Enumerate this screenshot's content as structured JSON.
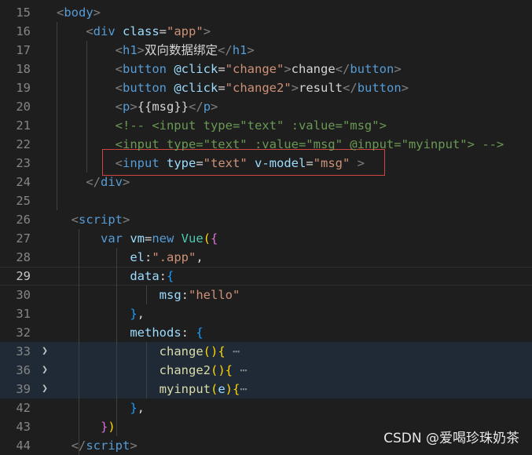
{
  "editor": {
    "lines": [
      {
        "num": "15",
        "code": [
          [
            "bracket",
            "<"
          ],
          [
            "tag",
            "body"
          ],
          [
            "bracket",
            ">"
          ]
        ]
      },
      {
        "num": "16",
        "code": [
          [
            "txt",
            "    "
          ],
          [
            "bracket",
            "<"
          ],
          [
            "tag",
            "div "
          ],
          [
            "attr",
            "class"
          ],
          [
            "punc",
            "="
          ],
          [
            "str",
            "\"app\""
          ],
          [
            "bracket",
            ">"
          ]
        ]
      },
      {
        "num": "17",
        "code": [
          [
            "txt",
            "        "
          ],
          [
            "bracket",
            "<"
          ],
          [
            "tag",
            "h1"
          ],
          [
            "bracket",
            ">"
          ],
          [
            "txt",
            "双向数据绑定"
          ],
          [
            "bracket",
            "</"
          ],
          [
            "tag",
            "h1"
          ],
          [
            "bracket",
            ">"
          ]
        ]
      },
      {
        "num": "18",
        "code": [
          [
            "txt",
            "        "
          ],
          [
            "bracket",
            "<"
          ],
          [
            "tag",
            "button "
          ],
          [
            "attr",
            "@click"
          ],
          [
            "punc",
            "="
          ],
          [
            "str",
            "\"change\""
          ],
          [
            "bracket",
            ">"
          ],
          [
            "txt",
            "change"
          ],
          [
            "bracket",
            "</"
          ],
          [
            "tag",
            "button"
          ],
          [
            "bracket",
            ">"
          ]
        ]
      },
      {
        "num": "19",
        "code": [
          [
            "txt",
            "        "
          ],
          [
            "bracket",
            "<"
          ],
          [
            "tag",
            "button "
          ],
          [
            "attr",
            "@click"
          ],
          [
            "punc",
            "="
          ],
          [
            "str",
            "\"change2\""
          ],
          [
            "bracket",
            ">"
          ],
          [
            "txt",
            "result"
          ],
          [
            "bracket",
            "</"
          ],
          [
            "tag",
            "button"
          ],
          [
            "bracket",
            ">"
          ]
        ]
      },
      {
        "num": "20",
        "code": [
          [
            "txt",
            "        "
          ],
          [
            "bracket",
            "<"
          ],
          [
            "tag",
            "p"
          ],
          [
            "bracket",
            ">"
          ],
          [
            "txt",
            "{{msg}}"
          ],
          [
            "bracket",
            "</"
          ],
          [
            "tag",
            "p"
          ],
          [
            "bracket",
            ">"
          ]
        ]
      },
      {
        "num": "21",
        "code": [
          [
            "txt",
            "        "
          ],
          [
            "comment",
            "<!-- <input type=\"text\" :value=\"msg\">"
          ]
        ]
      },
      {
        "num": "22",
        "code": [
          [
            "txt",
            "        "
          ],
          [
            "comment",
            "<input type=\"text\" :value=\"msg\" @input=\"myinput\"> -->"
          ]
        ]
      },
      {
        "num": "23",
        "code": [
          [
            "txt",
            "        "
          ],
          [
            "bracket",
            "<"
          ],
          [
            "tag",
            "input "
          ],
          [
            "attr",
            "type"
          ],
          [
            "punc",
            "="
          ],
          [
            "str",
            "\"text\""
          ],
          [
            "attr",
            " v-model"
          ],
          [
            "punc",
            "="
          ],
          [
            "str",
            "\"msg\""
          ],
          [
            "bracket",
            " >"
          ]
        ]
      },
      {
        "num": "24",
        "code": [
          [
            "txt",
            "    "
          ],
          [
            "bracket",
            "</"
          ],
          [
            "tag",
            "div"
          ],
          [
            "bracket",
            ">"
          ]
        ]
      },
      {
        "num": "25",
        "code": []
      },
      {
        "num": "26",
        "code": [
          [
            "txt",
            "  "
          ],
          [
            "bracket",
            "<"
          ],
          [
            "tag",
            "script"
          ],
          [
            "bracket",
            ">"
          ]
        ]
      },
      {
        "num": "27",
        "code": [
          [
            "txt",
            "      "
          ],
          [
            "kw",
            "var "
          ],
          [
            "prop",
            "vm"
          ],
          [
            "punc",
            "="
          ],
          [
            "kw",
            "new "
          ],
          [
            "cls",
            "Vue"
          ],
          [
            "brace1",
            "("
          ],
          [
            "brace2",
            "{"
          ]
        ]
      },
      {
        "num": "28",
        "code": [
          [
            "txt",
            "          "
          ],
          [
            "prop",
            "el"
          ],
          [
            "punc",
            ":"
          ],
          [
            "str",
            "\".app\""
          ],
          [
            "punc",
            ","
          ]
        ]
      },
      {
        "num": "29",
        "code": [
          [
            "txt",
            "          "
          ],
          [
            "prop",
            "data"
          ],
          [
            "punc",
            ":"
          ],
          [
            "brace3",
            "{"
          ]
        ]
      },
      {
        "num": "30",
        "code": [
          [
            "txt",
            "              "
          ],
          [
            "prop",
            "msg"
          ],
          [
            "punc",
            ":"
          ],
          [
            "str",
            "\"hello\""
          ]
        ]
      },
      {
        "num": "31",
        "code": [
          [
            "txt",
            "          "
          ],
          [
            "brace3",
            "}"
          ],
          [
            "punc",
            ","
          ]
        ]
      },
      {
        "num": "32",
        "code": [
          [
            "txt",
            "          "
          ],
          [
            "prop",
            "methods"
          ],
          [
            "punc",
            ": "
          ],
          [
            "brace3",
            "{"
          ]
        ]
      },
      {
        "num": "33",
        "code": [
          [
            "txt",
            "              "
          ],
          [
            "fn",
            "change"
          ],
          [
            "brace1",
            "()"
          ],
          [
            "brace1",
            "{"
          ],
          [
            "ellipsis",
            " ⋯"
          ]
        ]
      },
      {
        "num": "36",
        "code": [
          [
            "txt",
            "              "
          ],
          [
            "fn",
            "change2"
          ],
          [
            "brace1",
            "()"
          ],
          [
            "brace1",
            "{"
          ],
          [
            "ellipsis",
            " ⋯"
          ]
        ]
      },
      {
        "num": "39",
        "code": [
          [
            "txt",
            "              "
          ],
          [
            "fn",
            "myinput"
          ],
          [
            "brace1",
            "("
          ],
          [
            "prop",
            "e"
          ],
          [
            "brace1",
            ")"
          ],
          [
            "brace1",
            "{"
          ],
          [
            "ellipsis",
            "⋯"
          ]
        ]
      },
      {
        "num": "42",
        "code": [
          [
            "txt",
            "          "
          ],
          [
            "brace3",
            "}"
          ],
          [
            "punc",
            ","
          ]
        ]
      },
      {
        "num": "43",
        "code": [
          [
            "txt",
            "      "
          ],
          [
            "brace2",
            "}"
          ],
          [
            "brace1",
            ")"
          ]
        ]
      },
      {
        "num": "44",
        "code": [
          [
            "txt",
            "  "
          ],
          [
            "bracket",
            "</"
          ],
          [
            "tag",
            "script"
          ],
          [
            "bracket",
            ">"
          ]
        ]
      }
    ],
    "active_line": "29",
    "folded_lines": [
      "33",
      "36",
      "39"
    ],
    "fold_icon": "chevron-right-icon"
  },
  "watermark": "CSDN @爱喝珍珠奶茶"
}
